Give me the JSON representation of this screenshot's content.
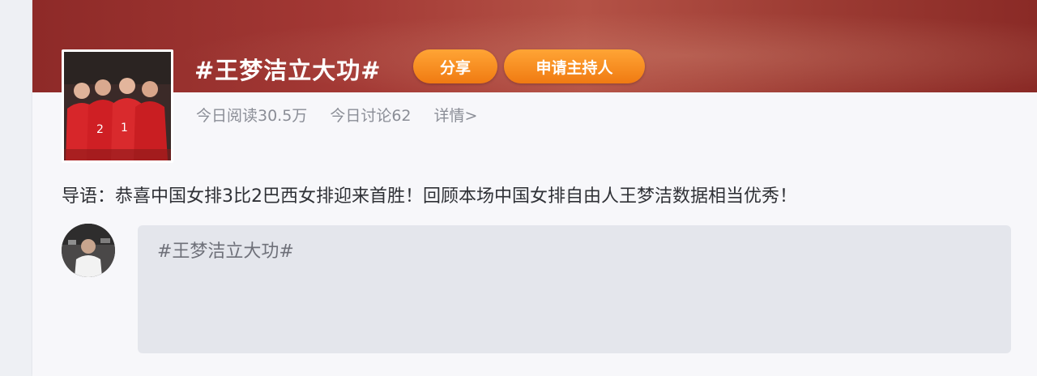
{
  "topic": {
    "title": "#王梦洁立大功#",
    "share_label": "分享",
    "apply_host_label": "申请主持人"
  },
  "stats": {
    "reads": "今日阅读30.5万",
    "discussions": "今日讨论62",
    "detail_link": "详情>"
  },
  "intro": "导语：恭喜中国女排3比2巴西女排迎来首胜！回顾本场中国女排自由人王梦洁数据相当优秀！",
  "composer": {
    "text": "#王梦洁立大功#"
  },
  "colors": {
    "banner": "#a23834",
    "button": "#f58a1f",
    "composer_bg": "#e4e6ec"
  }
}
